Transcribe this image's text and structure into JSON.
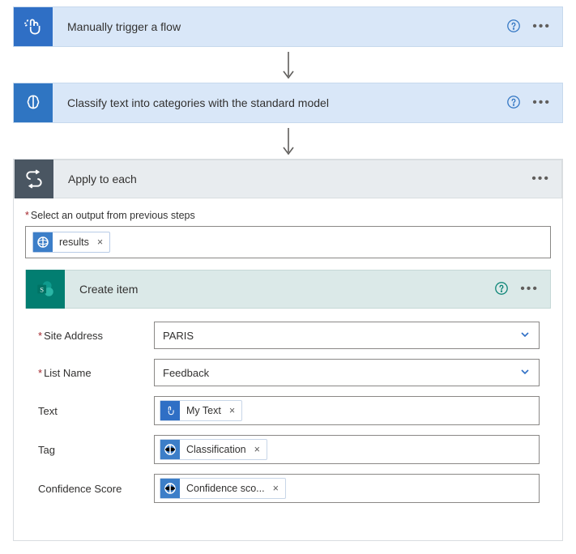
{
  "step1": {
    "title": "Manually trigger a flow"
  },
  "step2": {
    "title": "Classify text into categories with the standard model"
  },
  "loop": {
    "title": "Apply to each",
    "output_label": "Select an output from previous steps",
    "output_token": "results"
  },
  "createItem": {
    "title": "Create item",
    "fields": {
      "siteAddress": {
        "label": "Site Address",
        "value": "PARIS"
      },
      "listName": {
        "label": "List Name",
        "value": "Feedback"
      },
      "text": {
        "label": "Text",
        "token": "My Text"
      },
      "tag": {
        "label": "Tag",
        "token": "Classification"
      },
      "confidence": {
        "label": "Confidence Score",
        "token": "Confidence sco..."
      }
    }
  }
}
